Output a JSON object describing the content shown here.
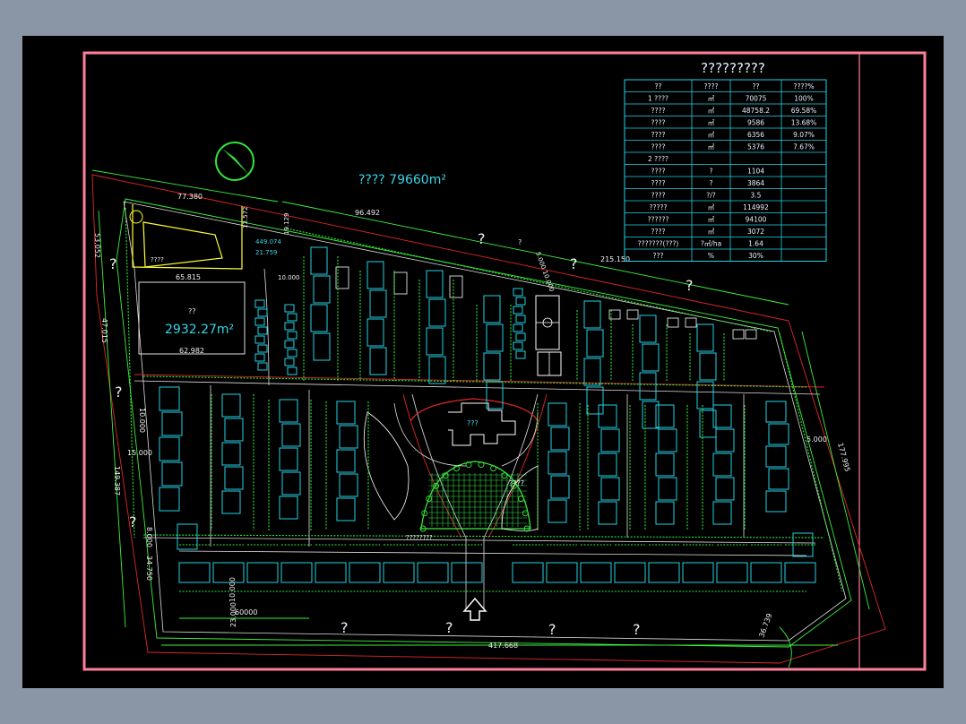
{
  "table": {
    "title": "?????????",
    "headers": [
      "??",
      "????",
      "??",
      "????%"
    ],
    "rows": [
      [
        "1 ????",
        "㎡",
        "70075",
        "100%"
      ],
      [
        "????",
        "㎡",
        "48758.2",
        "69.58%"
      ],
      [
        "????",
        "㎡",
        "9586",
        "13.68%"
      ],
      [
        "????",
        "㎡",
        "6356",
        "9.07%"
      ],
      [
        "????",
        "㎡",
        "5376",
        "7.67%"
      ],
      [
        "2 ????",
        "",
        "",
        ""
      ],
      [
        "????",
        "?",
        "1104",
        ""
      ],
      [
        "????",
        "?",
        "3864",
        ""
      ],
      [
        "????",
        "?/?",
        "3.5",
        ""
      ],
      [
        "?????",
        "㎡",
        "114992",
        ""
      ],
      [
        "??????",
        "㎡",
        "94100",
        ""
      ],
      [
        "????",
        "㎡",
        "3072",
        ""
      ],
      [
        "???????(???)",
        "?㎡/ha",
        "1.64",
        ""
      ],
      [
        "???",
        "%",
        "30%",
        ""
      ]
    ]
  },
  "site": {
    "total_area_label": "????  79660m²",
    "plot_area": "2932.27m²",
    "plot_label": "??",
    "sub_plot_label": "????",
    "small_plot_values": [
      "449.074",
      "21.759"
    ],
    "center_building_label": "???",
    "plaza_label": "????",
    "plaza_caption": "????????",
    "dimensions": {
      "top_left": "77.380",
      "top_mid": "96.492",
      "top_right": "215.150",
      "left_top": "53.052",
      "left_mid": "47.015",
      "left_low": "149.387",
      "plot_width": "65.815",
      "plot_width2": "62.982",
      "bottom": "417.668",
      "bottom_seg": "23.000",
      "bottom_seg2": "60000",
      "right_side": "177.995",
      "right_low": "36.739",
      "spacing_a": "15.000",
      "spacing_b": "10.000",
      "spacing_c": "5.000",
      "spacing_d": "8.000",
      "spacing_e": "34.750",
      "misc_a": "13.572",
      "misc_b": "19.129",
      "misc_c": "5.000 10.000",
      "misc_d": "10.000"
    },
    "question_marks": [
      "?",
      "?",
      "?",
      "?",
      "?",
      "?",
      "?",
      "?",
      "?",
      "?",
      "?"
    ]
  },
  "colors": {
    "background": "#8a96a6",
    "canvas": "#000000",
    "frame": "#ff7f9a",
    "building": "#22d4e6",
    "tree": "#31e83a",
    "road": "#e0e0e0",
    "redline": "#e02828",
    "boundary_yellow": "#ffff33"
  },
  "icons": [
    "north-arrow-icon",
    "entrance-arrow-icon"
  ]
}
